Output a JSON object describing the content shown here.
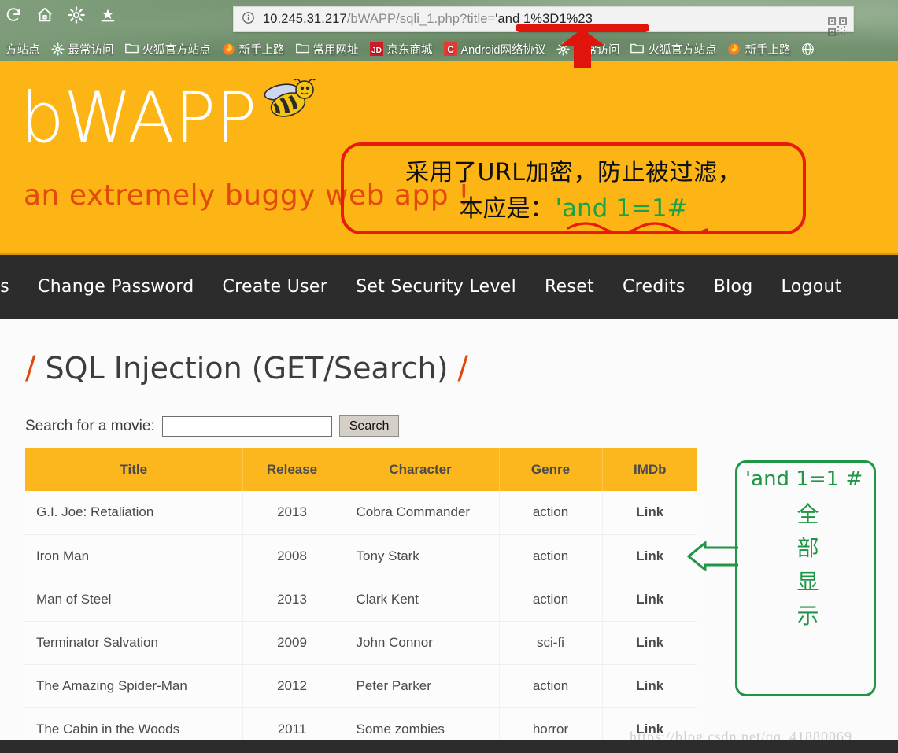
{
  "browser": {
    "toolbar_icons": [
      "reload-icon",
      "home-icon",
      "gear-icon",
      "bookmark-star-icon"
    ],
    "url_host": "10.245.31.217",
    "url_path": "/bWAPP/sqli_1.php?title=",
    "url_payload": "'and 1%3D1%23",
    "url_full": "10.245.31.217/bWAPP/sqli_1.php?title='and 1%3D1%23",
    "info_icon": "info-circle-icon",
    "qr_icon": "qr-code-icon",
    "bookmarks": [
      {
        "icon": "none",
        "label": "方站点"
      },
      {
        "icon": "gear-icon",
        "label": "最常访问"
      },
      {
        "icon": "folder-icon",
        "label": "火狐官方站点"
      },
      {
        "icon": "firefox-icon",
        "label": "新手上路"
      },
      {
        "icon": "folder-icon",
        "label": "常用网址"
      },
      {
        "icon": "jd-icon",
        "label": "京东商城"
      },
      {
        "icon": "csdn-icon",
        "label": "Android网络协议"
      },
      {
        "icon": "gear-icon",
        "label": "最常访问"
      },
      {
        "icon": "folder-icon",
        "label": "火狐官方站点"
      },
      {
        "icon": "firefox-icon",
        "label": "新手上路"
      },
      {
        "icon": "globe-icon",
        "label": ""
      }
    ]
  },
  "header": {
    "logo_text": "bWAPP",
    "bee_icon": "bee-icon",
    "tagline": "an extremely buggy web app !",
    "brand_color": "#fdb515"
  },
  "annotation_red": {
    "line1": "采用了URL加密，防止被过滤，",
    "line2_prefix": "本应是：",
    "line2_payload": "'and 1=1#",
    "border_color": "#e81b0c",
    "payload_color": "#1aa245",
    "arrow_icon": "up-arrow-icon"
  },
  "nav": {
    "items": [
      "gs",
      "Change Password",
      "Create User",
      "Set Security Level",
      "Reset",
      "Credits",
      "Blog",
      "Logout"
    ]
  },
  "page": {
    "title_slash_left": "/",
    "title": "SQL Injection (GET/Search)",
    "title_slash_right": "/",
    "search_label": "Search for a movie:",
    "search_value": "",
    "search_placeholder": "",
    "search_button": "Search"
  },
  "table": {
    "columns": [
      "Title",
      "Release",
      "Character",
      "Genre",
      "IMDb"
    ],
    "rows": [
      {
        "title": "G.I. Joe: Retaliation",
        "release": "2013",
        "character": "Cobra Commander",
        "genre": "action",
        "imdb": "Link"
      },
      {
        "title": "Iron Man",
        "release": "2008",
        "character": "Tony Stark",
        "genre": "action",
        "imdb": "Link"
      },
      {
        "title": "Man of Steel",
        "release": "2013",
        "character": "Clark Kent",
        "genre": "action",
        "imdb": "Link"
      },
      {
        "title": "Terminator Salvation",
        "release": "2009",
        "character": "John Connor",
        "genre": "sci-fi",
        "imdb": "Link"
      },
      {
        "title": "The Amazing Spider-Man",
        "release": "2012",
        "character": "Peter Parker",
        "genre": "action",
        "imdb": "Link"
      },
      {
        "title": "The Cabin in the Woods",
        "release": "2011",
        "character": "Some zombies",
        "genre": "horror",
        "imdb": "Link"
      }
    ]
  },
  "annotation_green": {
    "payload": "'and 1=1 #",
    "vertical_chars": [
      "全",
      "部",
      "显",
      "示"
    ],
    "border_color": "#1f9646",
    "arrow_icon": "left-arrow-icon"
  },
  "watermark": "https://blog.csdn.net/qq_41880069"
}
